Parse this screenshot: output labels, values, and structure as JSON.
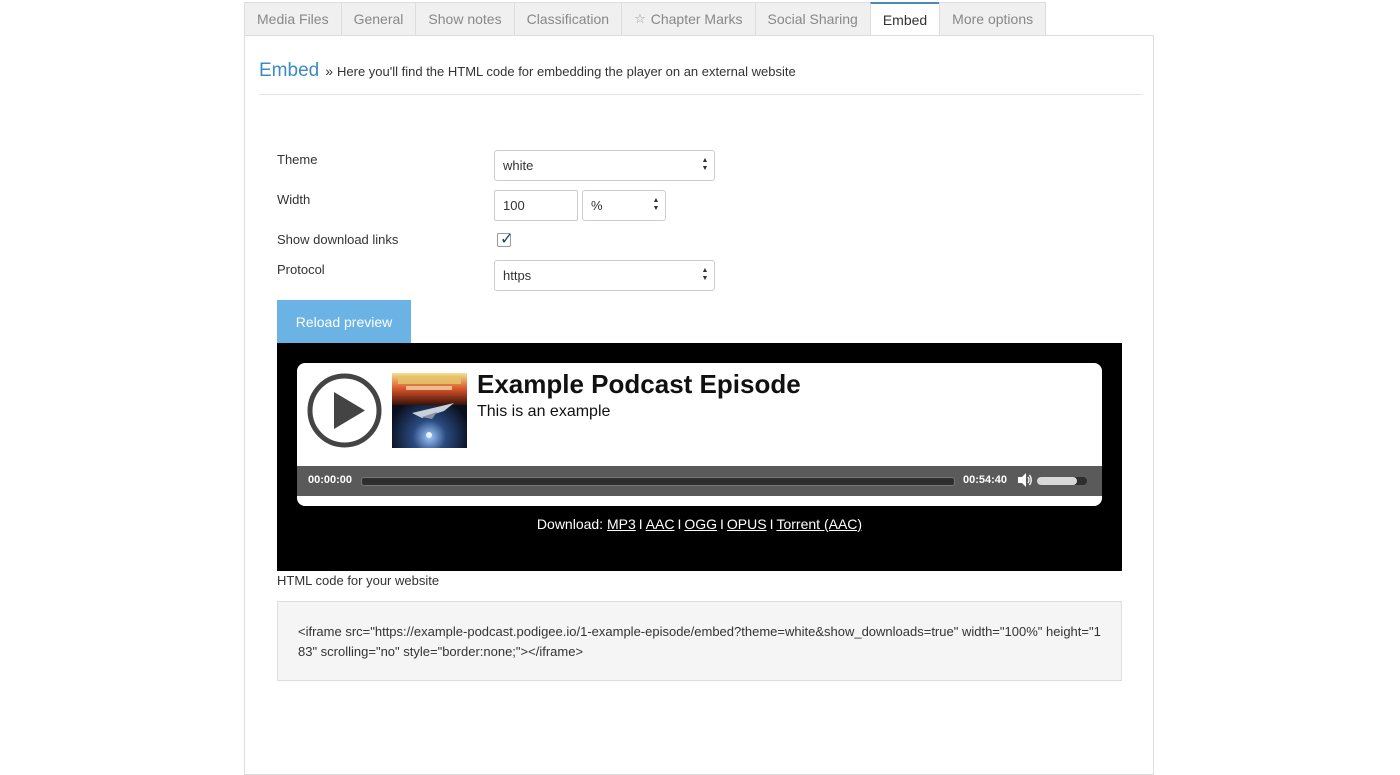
{
  "tabs": [
    {
      "label": "Media Files",
      "active": false
    },
    {
      "label": "General",
      "active": false
    },
    {
      "label": "Show notes",
      "active": false
    },
    {
      "label": "Classification",
      "active": false
    },
    {
      "label": "Chapter Marks",
      "active": false,
      "icon": "star-icon"
    },
    {
      "label": "Social Sharing",
      "active": false
    },
    {
      "label": "Embed",
      "active": true
    },
    {
      "label": "More options",
      "active": false
    }
  ],
  "section": {
    "title": "Embed",
    "separator": "»",
    "description": "Here you'll find the HTML code for embedding the player on an external website"
  },
  "form": {
    "theme_label": "Theme",
    "theme_value": "white",
    "width_label": "Width",
    "width_value": "100",
    "width_unit": "%",
    "show_downloads_label": "Show download links",
    "show_downloads_checked": true,
    "protocol_label": "Protocol",
    "protocol_value": "https",
    "reload_button": "Reload preview"
  },
  "player": {
    "episode_title": "Example Podcast Episode",
    "episode_subtitle": "This is an example",
    "cover_alt": "DARK SPACE",
    "current_time": "00:00:00",
    "duration": "00:54:40",
    "volume_fraction": 0.8,
    "download_prefix": "Download:",
    "downloads": [
      "MP3",
      "AAC",
      "OGG",
      "OPUS",
      "Torrent (AAC)"
    ],
    "download_separator": "I"
  },
  "code": {
    "label": "HTML code for your website",
    "snippet": "<iframe src=\"https://example-podcast.podigee.io/1-example-episode/embed?theme=white&show_downloads=true\" width=\"100%\" height=\"183\" scrolling=\"no\" style=\"border:none;\"></iframe>"
  },
  "colors": {
    "accent": "#3d8bc4",
    "button": "#6bb3e4",
    "player_bg": "#000000",
    "controls_bg": "#5a5a5a"
  }
}
